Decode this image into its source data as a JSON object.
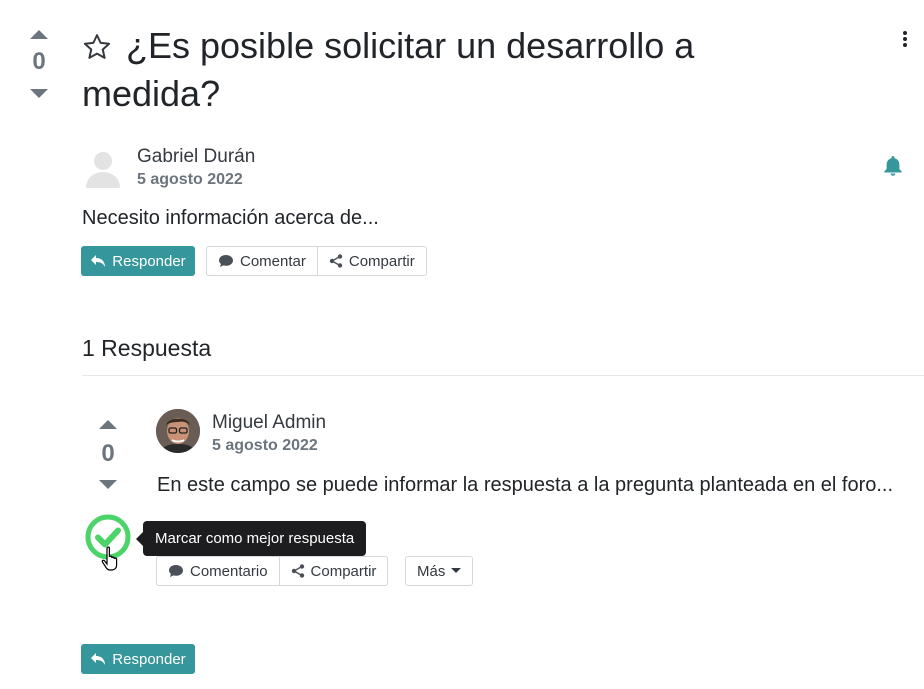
{
  "question": {
    "votes": "0",
    "title": "¿Es posible solicitar un desarrollo a medida?",
    "author": {
      "name": "Gabriel Durán",
      "date": "5 agosto 2022"
    },
    "body": "Necesito información acerca de...",
    "buttons": {
      "reply": "Responder",
      "comment": "Comentar",
      "share": "Compartir"
    }
  },
  "answers_header": "1 Respuesta",
  "answer": {
    "votes": "0",
    "author": {
      "name": "Miguel Admin",
      "date": "5 agosto 2022"
    },
    "body": "En este campo se puede informar la respuesta a la pregunta planteada en el foro...",
    "buttons": {
      "comment": "Comentario",
      "share": "Compartir",
      "more": "Más"
    },
    "tooltip": "Marcar como mejor respuesta"
  },
  "footer": {
    "reply": "Responder"
  },
  "colors": {
    "accent": "#35979c",
    "accept_green": "#4cd36a",
    "tooltip_bg": "#1d1d1f"
  },
  "icons": [
    "star-icon",
    "kebab-menu-icon",
    "bell-icon",
    "reply-icon",
    "comment-icon",
    "share-icon",
    "check-icon",
    "hand-cursor-icon",
    "caret-down-icon"
  ]
}
